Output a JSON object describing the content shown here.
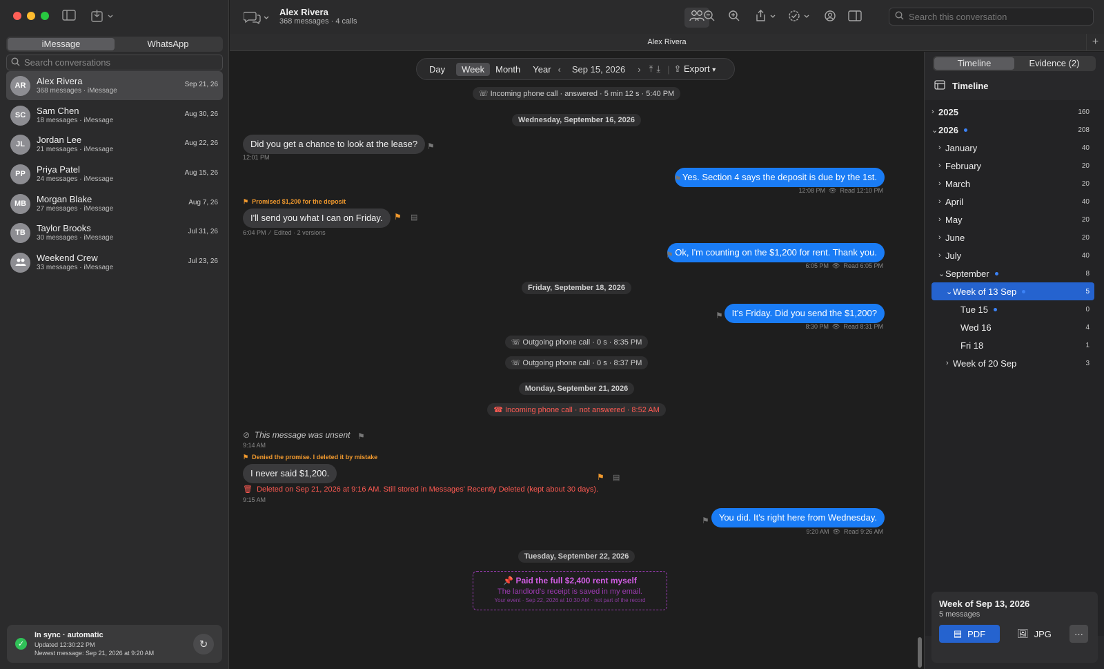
{
  "window": {
    "plus_label": "+"
  },
  "sidebar": {
    "tabs": [
      {
        "label": "iMessage"
      },
      {
        "label": "WhatsApp"
      }
    ],
    "search": {
      "placeholder": "Search conversations"
    },
    "conversations": [
      {
        "initials": "AR",
        "name": "Alex Rivera",
        "subtitle": "368 messages · iMessage",
        "date": "Sep 21, 26"
      },
      {
        "initials": "SC",
        "name": "Sam Chen",
        "subtitle": "18 messages · iMessage",
        "date": "Aug 30, 26"
      },
      {
        "initials": "JL",
        "name": "Jordan Lee",
        "subtitle": "21 messages · iMessage",
        "date": "Aug 22, 26"
      },
      {
        "initials": "PP",
        "name": "Priya Patel",
        "subtitle": "24 messages · iMessage",
        "date": "Aug 15, 26"
      },
      {
        "initials": "MB",
        "name": "Morgan Blake",
        "subtitle": "27 messages · iMessage",
        "date": "Aug 7, 26"
      },
      {
        "initials": "TB",
        "name": "Taylor Brooks",
        "subtitle": "30 messages · iMessage",
        "date": "Jul 31, 26"
      },
      {
        "initials": "",
        "name": "Weekend Crew",
        "subtitle": "33 messages · iMessage",
        "date": "Jul 23, 26"
      }
    ],
    "sync": {
      "title": "In sync · automatic",
      "updated": "Updated 12:30:22 PM",
      "newest": "Newest message: Sep 21, 2026 at 9:20 AM"
    }
  },
  "header": {
    "name": "Alex Rivera",
    "subtitle": "368 messages · 4 calls",
    "strip_title": "Alex Rivera",
    "search_placeholder": "Search this conversation"
  },
  "range_bar": {
    "day": "Day",
    "week": "Week",
    "month": "Month",
    "year": "Year",
    "date": "Sep 15, 2026",
    "export": "Export"
  },
  "chat": {
    "call1": "Incoming phone call · answered · 5 min 12 s · 5:40 PM",
    "date_wed": "Wednesday, September 16, 2026",
    "msg1": "Did you get a chance to look at the lease?",
    "msg1_time": "12:01 PM",
    "msg2": "Yes. Section 4 says the deposit is due by the 1st.",
    "msg2_time": "12:08 PM",
    "msg2_read": "Read 12:10 PM",
    "note1": "Promised $1,200 for the deposit",
    "msg3": "I'll send you what I can on Friday.",
    "msg3_time": "6:04 PM",
    "msg3_edited": "Edited · 2 versions",
    "msg4": "Ok, I'm counting on the $1,200 for rent. Thank you.",
    "msg4_time": "6:05 PM",
    "msg4_read": "Read 6:05 PM",
    "date_fri": "Friday, September 18, 2026",
    "msg5": "It's Friday. Did you send the $1,200?",
    "msg5_time": "8:30 PM",
    "msg5_read": "Read 8:31 PM",
    "call2": "Outgoing phone call · 0 s · 8:35 PM",
    "call3": "Outgoing phone call · 0 s · 8:37 PM",
    "date_mon": "Monday, September 21, 2026",
    "call4": "Incoming phone call · not answered · 8:52 AM",
    "unsent": "This message was unsent",
    "unsent_time": "9:14 AM",
    "note2": "Denied the promise. I deleted it by mistake",
    "msg6": "I never said $1,200.",
    "deleted_note": "Deleted on Sep 21, 2026 at 9:16 AM. Still stored in Messages' Recently Deleted (kept about 30 days).",
    "msg6_time": "9:15 AM",
    "msg7": "You did. It's right here from Wednesday.",
    "msg7_time": "9:20 AM",
    "msg7_read": "Read 9:26 AM",
    "date_tue": "Tuesday, September 22, 2026",
    "event_title": "Paid the full $2,400 rent myself",
    "event_body": "The landlord's receipt is saved in my email.",
    "event_meta": "Your event · Sep 22, 2026 at 10:30 AM · not part of the record"
  },
  "right_panel": {
    "tabs": [
      {
        "label": "Timeline"
      },
      {
        "label": "Evidence (2)"
      }
    ],
    "heading": "Timeline",
    "tree": [
      {
        "label": "2025",
        "count": "160"
      },
      {
        "label": "2026",
        "count": "208"
      },
      {
        "label": "January",
        "count": "40"
      },
      {
        "label": "February",
        "count": "20"
      },
      {
        "label": "March",
        "count": "20"
      },
      {
        "label": "April",
        "count": "40"
      },
      {
        "label": "May",
        "count": "20"
      },
      {
        "label": "June",
        "count": "20"
      },
      {
        "label": "July",
        "count": "40"
      },
      {
        "label": "September",
        "count": "8"
      },
      {
        "label": "Week of 13 Sep",
        "count": "5"
      },
      {
        "label": "Tue 15",
        "count": "0"
      },
      {
        "label": "Wed 16",
        "count": "4"
      },
      {
        "label": "Fri 18",
        "count": "1"
      },
      {
        "label": "Week of 20 Sep",
        "count": "3"
      }
    ],
    "summary": {
      "title": "Week of Sep 13, 2026",
      "subtitle": "5 messages",
      "pdf": "PDF",
      "jpg": "JPG",
      "more": "···"
    }
  },
  "colors": {
    "accent": "#1a7cf5",
    "flag": "#f29a2e",
    "missed": "#ff5a52",
    "event": "#d45ee6",
    "sync_ok": "#30c158"
  }
}
